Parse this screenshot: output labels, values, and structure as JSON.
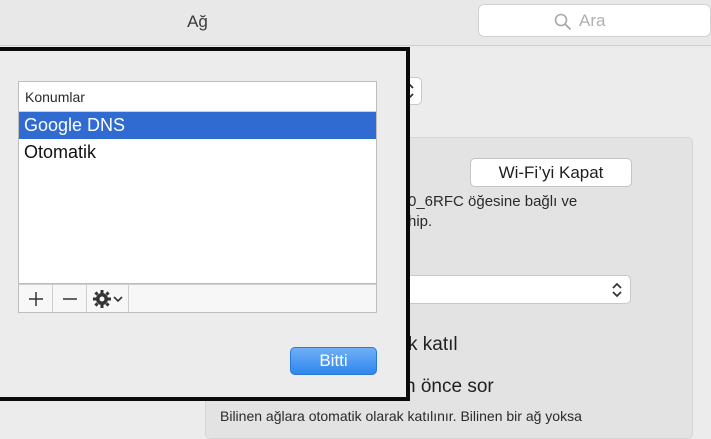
{
  "window": {
    "title": "Ağ"
  },
  "search": {
    "placeholder": "Ara",
    "icon": "search-icon"
  },
  "background": {
    "wifi_off_button": "Wi-Fi’yi Kapat",
    "status_line1": "0_6RFC öğesine bağlı ve",
    "status_line2": "hip.",
    "auto_join_label": "k katıl",
    "ask_label": "n önce sor",
    "help_text": "Bilinen ağlara otomatik olarak katılınır. Bilinen bir ağ yoksa"
  },
  "sheet": {
    "list_header": "Konumlar",
    "locations": [
      {
        "label": "Google DNS",
        "selected": true
      },
      {
        "label": "Otomatik",
        "selected": false
      }
    ],
    "toolbar": {
      "add": "+",
      "remove": "−",
      "action_icon": "gear-icon"
    },
    "done_button": "Bitti"
  },
  "colors": {
    "selection": "#2f6bd0",
    "primary_button": "#2f86ec",
    "sheet_border": "#0a0a0a"
  }
}
